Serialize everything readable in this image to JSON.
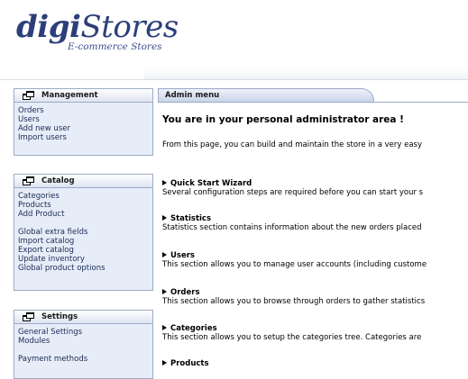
{
  "logo": {
    "brand_bold": "digi",
    "brand_italic": "Stores",
    "tagline": "E-commerce Stores"
  },
  "sidebar": {
    "management": {
      "title": "Management",
      "items": [
        "Orders",
        "Users",
        "Add new user",
        "Import users"
      ]
    },
    "catalog": {
      "title": "Catalog",
      "items_a": [
        "Categories",
        "Products",
        "Add Product"
      ],
      "items_b": [
        "Global extra fields",
        "Import catalog",
        "Export catalog",
        "Update inventory",
        "Global product options"
      ]
    },
    "settings": {
      "title": "Settings",
      "items_a": [
        "General Settings",
        "Modules"
      ],
      "items_b": [
        "Payment methods"
      ]
    }
  },
  "main": {
    "tab_label": "Admin menu",
    "welcome": "You are in your personal administrator area !",
    "intro": "From this page, you can build and maintain the store in a very easy",
    "sections": [
      {
        "title": "Quick Start Wizard",
        "desc": "Several configuration steps are required before you can start your s"
      },
      {
        "title": "Statistics",
        "desc": "Statistics section contains information about the new orders placed"
      },
      {
        "title": "Users",
        "desc": "This section allows you to manage user accounts (including custome"
      },
      {
        "title": "Orders",
        "desc": "This section allows you to browse through orders to gather statistics"
      },
      {
        "title": "Categories",
        "desc": "This section allows you to setup the categories tree. Categories are"
      },
      {
        "title": "Products",
        "desc": ""
      }
    ]
  },
  "colors": {
    "brand": "#2c3f7a",
    "panel_bg": "#e7edf8",
    "border": "#9ca9c8"
  },
  "icons": {
    "box_title": "window-icon",
    "section_marker": "triangle-right-icon"
  }
}
